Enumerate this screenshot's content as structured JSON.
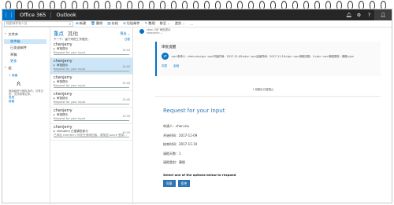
{
  "topbar": {
    "brand": "Office 365",
    "app": "Outlook",
    "icons": [
      "bell-icon",
      "gear-icon",
      "help-icon"
    ]
  },
  "commands": {
    "search_placeholder": "搜索邮件和人员",
    "items": [
      "新建",
      "删除",
      "存档",
      "垃圾邮件",
      "整理",
      "移至",
      "类别",
      "..."
    ]
  },
  "nav": {
    "folders_header": "文件夹",
    "folders": [
      "收件箱",
      "已发送邮件",
      "草稿",
      "更多"
    ],
    "groups_header": "组",
    "groups_new": "+ 新建",
    "group_desc": "使用组进行团队协作，分享日历、文件和笔记本。",
    "discover": "发现",
    "create": "新建"
  },
  "list": {
    "tab_focused": "重点",
    "tab_other": "其他",
    "filter": "筛选 ⌄",
    "subheader": "下一个：留下来把工作做完。",
    "subheader_right": "日程",
    "messages": [
      {
        "sender": "chenjerry",
        "subject": "审批提示",
        "preview": "Request for your input",
        "time": "15:55",
        "selected": false
      },
      {
        "sender": "chenjerry",
        "subject": "审批提示",
        "preview": "Request for your input",
        "time": "15:45",
        "selected": true
      },
      {
        "sender": "chenjerry",
        "subject": "审批提示",
        "preview": "Request for your input",
        "time": "15:40",
        "selected": false
      },
      {
        "sender": "chenjerry",
        "subject": "审批提示",
        "preview": "Request for your input",
        "time": "15:40",
        "selected": false
      },
      {
        "sender": "chenjerry",
        "subject": "审批提示",
        "preview": "Request for your input",
        "time": "15:39",
        "selected": false
      },
      {
        "sender": "chenjerry",
        "subject": "chenjerry 已邀请您参与",
        "preview": "已添加 chenjerry 你还在使用旧版。请按钮 Azure 登录...",
        "time": "15:25",
        "selected": false
      }
    ]
  },
  "reading": {
    "sender_line1": "chen.3@ 审批提示",
    "sender_line2": "chenjerry ⌄",
    "card_title": "审批提醒",
    "card_body": "<p>申请人：chen.xiu</p> <p>开始时间：2017-11-09</p> <p>结束时间：2017-11-10</p> <p>请假天数：1</p> <p>请假类别：事假</p>",
    "card_actions": [
      "同意",
      "拒绝"
    ],
    "attach_note": "1 张图片已被阻止",
    "request_title": "Request for your input",
    "details": [
      "申请人：chen.xiu",
      "开始时间：2017-11-09",
      "结束时间：2017-11-10",
      "请假天数：1",
      "请假类别：事假"
    ],
    "respond_prompt": "Select one of the options below to respond",
    "buttons": [
      "同意",
      "拒绝"
    ]
  },
  "colors": {
    "accent": "#0072c6",
    "topbar": "#262626",
    "selected": "#cde6f7",
    "title_blue": "#2e75b6"
  }
}
